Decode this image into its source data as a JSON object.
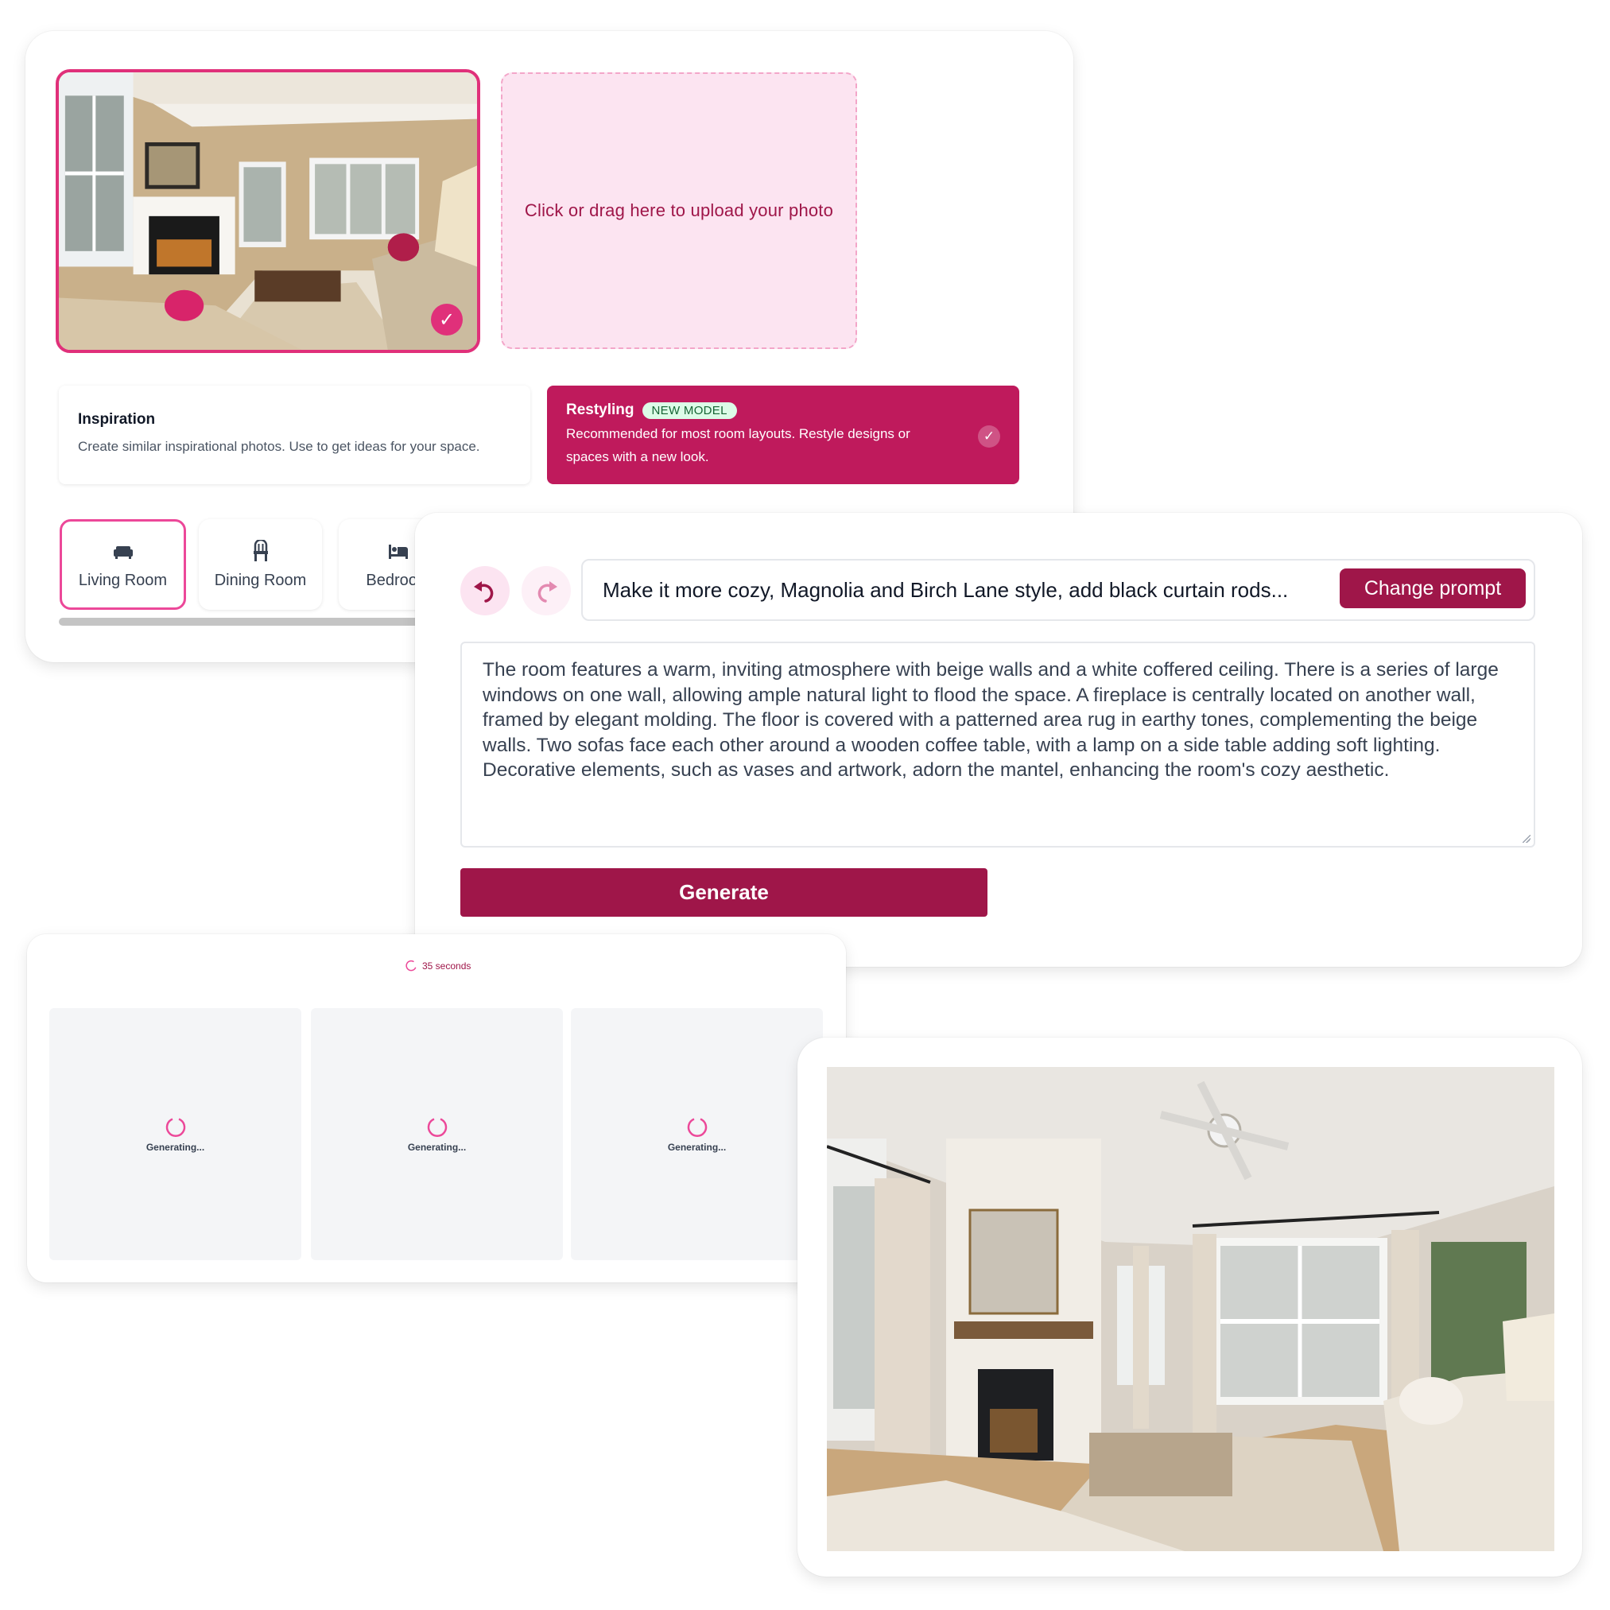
{
  "upload_panel": {
    "uploaded_photo": {
      "alt": "Original living room photo",
      "selected": true,
      "check_icon": "check-icon"
    },
    "upload_zone_text": "Click or drag here to upload your photo",
    "modes": [
      {
        "title": "Inspiration",
        "description": "Create similar inspirational photos. Use to get ideas for your space.",
        "selected": false
      },
      {
        "title": "Restyling",
        "badge": "NEW MODEL",
        "description": "Recommended for most room layouts. Restyle designs or spaces with a new look.",
        "selected": true
      }
    ],
    "room_types": [
      {
        "label": "Living Room",
        "icon": "sofa-icon",
        "selected": true
      },
      {
        "label": "Dining Room",
        "icon": "chair-icon",
        "selected": false
      },
      {
        "label": "Bedroom",
        "icon": "bed-icon",
        "selected": false
      }
    ]
  },
  "prompt_panel": {
    "undo_icon": "undo-icon",
    "redo_icon": "redo-icon",
    "prompt_value": "Make it more cozy, Magnolia and Birch Lane style, add black curtain rods...",
    "change_prompt_label": "Change prompt",
    "description": "The room features a warm, inviting atmosphere with beige walls and a white coffered ceiling. There is a series of large windows on one wall, allowing ample natural light to flood the space. A fireplace is centrally located on another wall, framed by elegant molding. The floor is covered with a patterned area rug in earthy tones, complementing the beige walls. Two sofas face each other around a wooden coffee table, with a lamp on a side table adding soft lighting. Decorative elements, such as vases and artwork, adorn the mantel, enhancing the room's cozy aesthetic.",
    "generate_label": "Generate"
  },
  "generating_panel": {
    "timer_text": "35 seconds",
    "tiles": [
      {
        "label": "Generating..."
      },
      {
        "label": "Generating..."
      },
      {
        "label": "Generating..."
      }
    ]
  },
  "result_panel": {
    "image_alt": "Restyled cozy living room with white brick fireplace and black curtain rods"
  },
  "colors": {
    "brand": "#9f1649",
    "accent_pink": "#e0307a",
    "restyling_bg": "#bf1a5c",
    "upload_bg": "#fce4f1",
    "badge_bg": "#dcfce7",
    "badge_text": "#166534"
  }
}
